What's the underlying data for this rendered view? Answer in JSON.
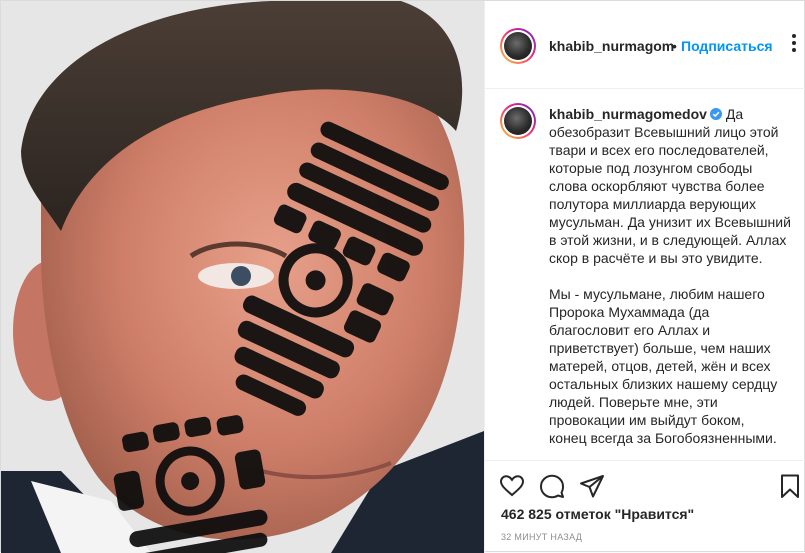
{
  "header": {
    "username": "khabib_nurmagom",
    "separator": "•",
    "follow_label": "Подписаться",
    "more_icon": "more-options-icon"
  },
  "caption": {
    "username": "khabib_nurmagomedov",
    "verified_icon": "verified-badge-icon",
    "paragraph1": [
      "Да",
      "обезобразит Всевышний лицо этой",
      "твари и всех его последователей,",
      "которые под лозунгом свободы",
      "слова оскорбляют чувства более",
      "полутора миллиарда верующих",
      "мусульман. Да унизит их Всевышний",
      "в этой жизни, и в следующей. Аллах",
      "скор в расчёте и вы это увидите."
    ],
    "paragraph2": [
      "Мы - мусульмане, любим нашего",
      "Пророка Мухаммада (да",
      "благословит его Аллах и",
      "приветствует) больше, чем наших",
      "матерей, отцов, детей, жён и всех",
      "остальных близких нашему сердцу",
      "людей. Поверьте мне, эти",
      "провокации им выйдут боком,",
      "конец всегда за Богобоязненными."
    ]
  },
  "actions": {
    "icons": [
      "heart-icon",
      "comment-icon",
      "share-icon",
      "bookmark-icon"
    ]
  },
  "likes_text": "462 825 отметок \"Нравится\"",
  "time_text": "32 МИНУТ НАЗАД",
  "colors": {
    "link_blue": "#0095f6",
    "verified_blue": "#3897f0",
    "text": "#262626",
    "muted": "#8e8e8e",
    "border": "#dbdbdb"
  }
}
